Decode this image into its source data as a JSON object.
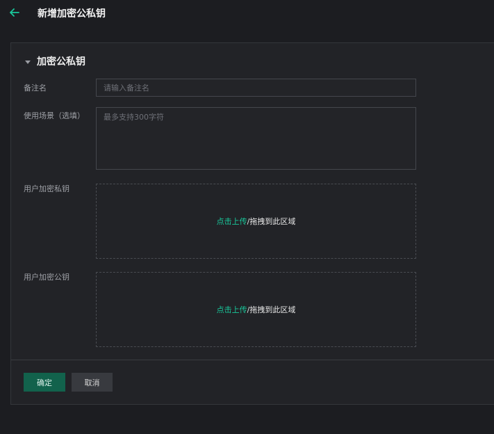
{
  "header": {
    "title": "新增加密公私钥",
    "back_icon": "arrow-left-icon"
  },
  "section": {
    "title": "加密公私钥"
  },
  "form": {
    "remark": {
      "label": "备注名",
      "placeholder": "请输入备注名",
      "value": ""
    },
    "scene": {
      "label": "使用场景（选填）",
      "placeholder": "最多支持300字符",
      "value": ""
    },
    "private_key": {
      "label": "用户加密私钥",
      "upload_link": "点击上传",
      "drop_text": "/拖拽到此区域"
    },
    "public_key": {
      "label": "用户加密公钥",
      "upload_link": "点击上传",
      "drop_text": "/拖拽到此区域"
    }
  },
  "footer": {
    "confirm_label": "确定",
    "cancel_label": "取消"
  },
  "colors": {
    "accent": "#19c79a",
    "confirm_bg": "#12624c",
    "background": "#1c1d21",
    "panel": "#222327"
  }
}
